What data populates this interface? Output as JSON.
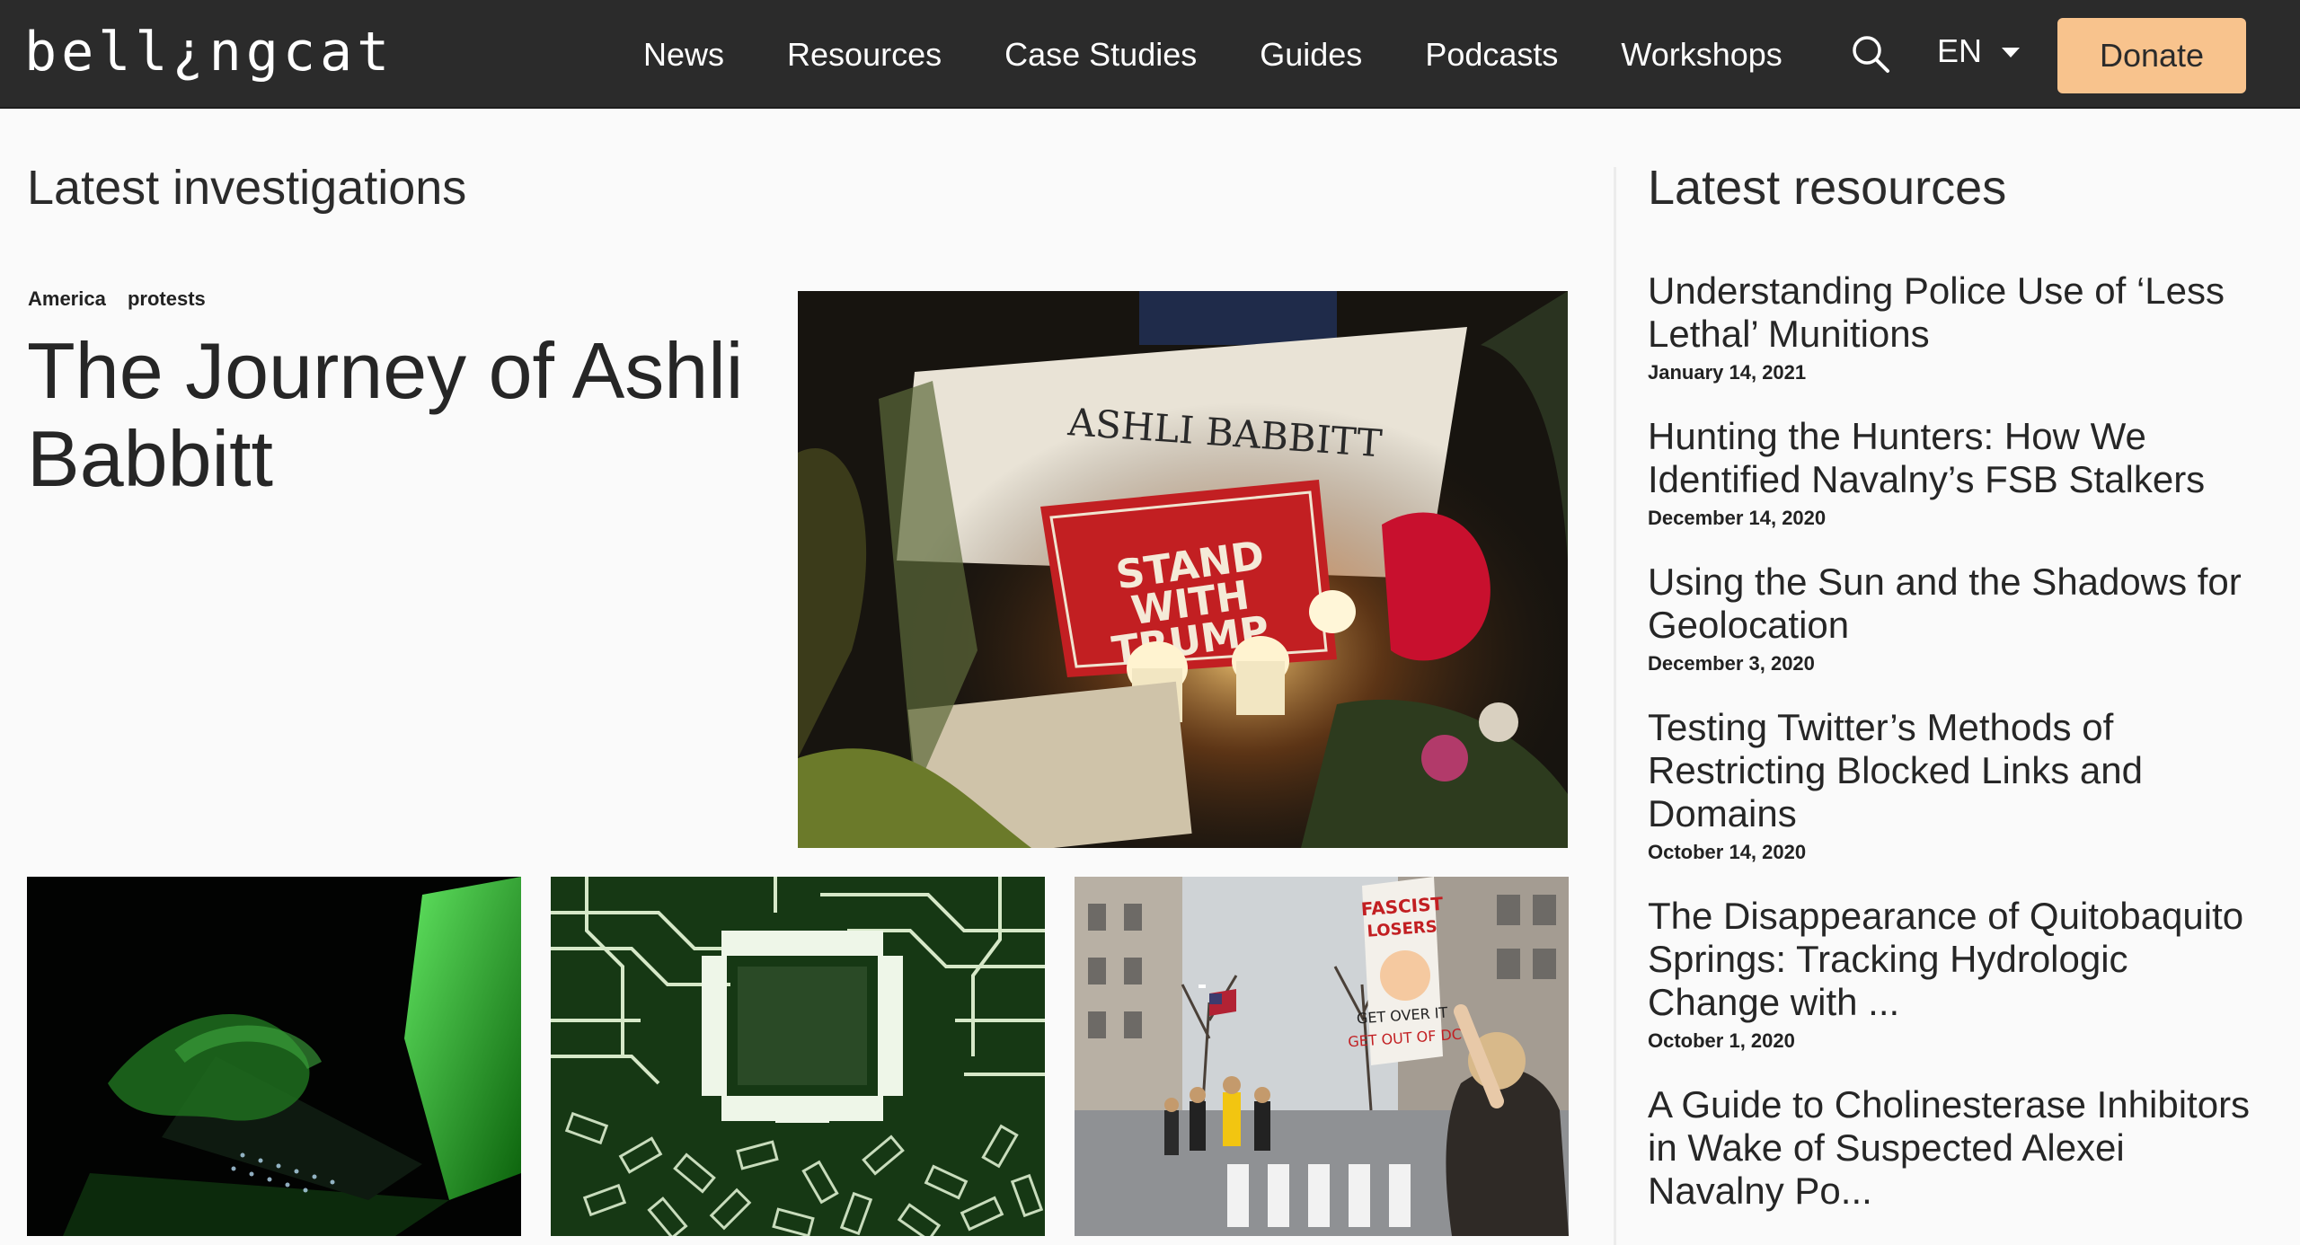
{
  "header": {
    "logo": "bell¿ngcat",
    "nav": [
      "News",
      "Resources",
      "Case Studies",
      "Guides",
      "Podcasts",
      "Workshops"
    ],
    "lang": "EN",
    "donate_label": "Donate"
  },
  "investigations": {
    "heading": "Latest investigations",
    "feature": {
      "tags": [
        "America",
        "protests"
      ],
      "title": "The Journey of Ashli Babbitt",
      "image": {
        "sign_name": "ASHLI BABBITT",
        "sign_slogan": [
          "STAND",
          "WITH",
          "TRUMP"
        ]
      }
    },
    "thumb_protest_sign": [
      "FASCIST",
      "LOSERS",
      "GET OVER IT",
      "GET OUT OF DC"
    ]
  },
  "resources": {
    "heading": "Latest resources",
    "items": [
      {
        "title": "Understanding Police Use of ‘Less Lethal’ Munitions",
        "date": "January 14, 2021"
      },
      {
        "title": "Hunting the Hunters: How We Identified Navalny’s FSB Stalkers",
        "date": "December 14, 2020"
      },
      {
        "title": "Using the Sun and the Shadows for Geolocation",
        "date": "December 3, 2020"
      },
      {
        "title": "Testing Twitter’s Methods of Restricting Blocked Links and Domains",
        "date": "October 14, 2020"
      },
      {
        "title": "The Disappearance of Quitobaquito Springs: Tracking Hydrologic Change with ...",
        "date": "October 1, 2020"
      },
      {
        "title": "A Guide to Cholinesterase Inhibitors in Wake of Suspected Alexei Navalny Po...",
        "date": ""
      }
    ]
  },
  "colors": {
    "header_bg": "#2b2b2b",
    "donate_bg": "#f8c38d",
    "page_bg": "#fafafa"
  }
}
